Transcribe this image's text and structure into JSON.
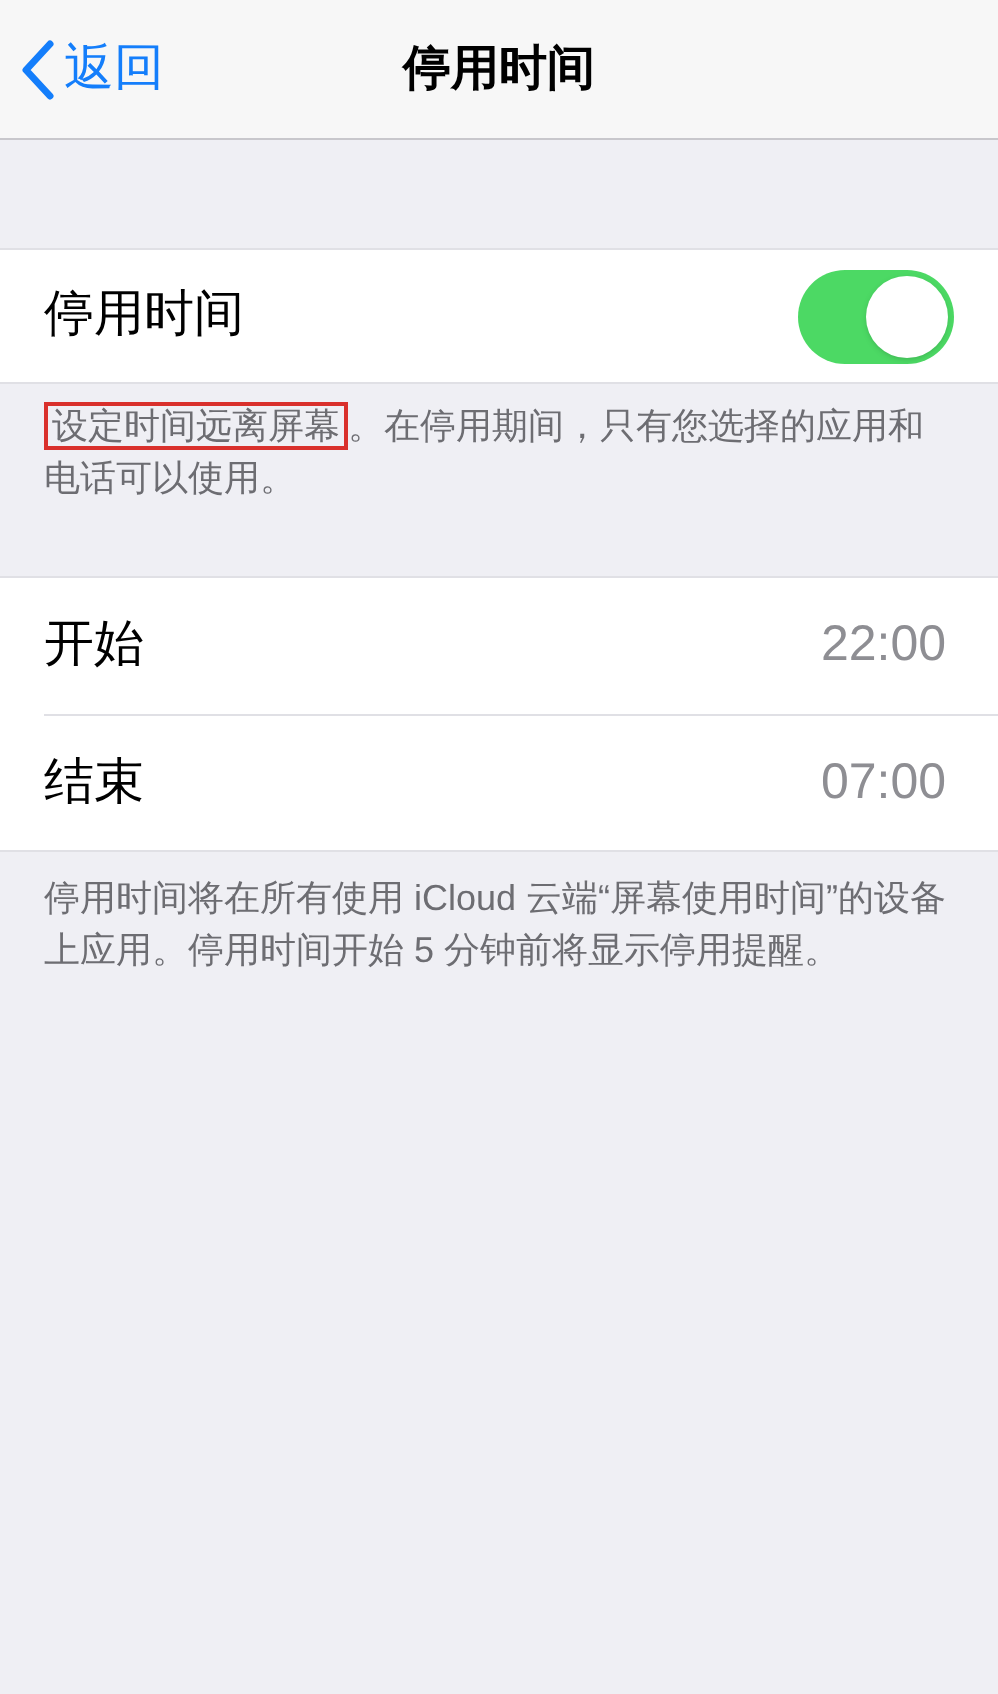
{
  "nav": {
    "back": "返回",
    "title": "停用时间"
  },
  "toggle_row": {
    "label": "停用时间",
    "on": true
  },
  "toggle_footer": {
    "highlighted": "设定时间远离屏幕",
    "rest": "。在停用期间，只有您选择的应用和电话可以使用。"
  },
  "time_rows": [
    {
      "label": "开始",
      "value": "22:00"
    },
    {
      "label": "结束",
      "value": "07:00"
    }
  ],
  "time_footer": "停用时间将在所有使用 iCloud 云端“屏幕使用时间”的设备上应用。停用时间开始 5 分钟前将显示停用提醒。"
}
